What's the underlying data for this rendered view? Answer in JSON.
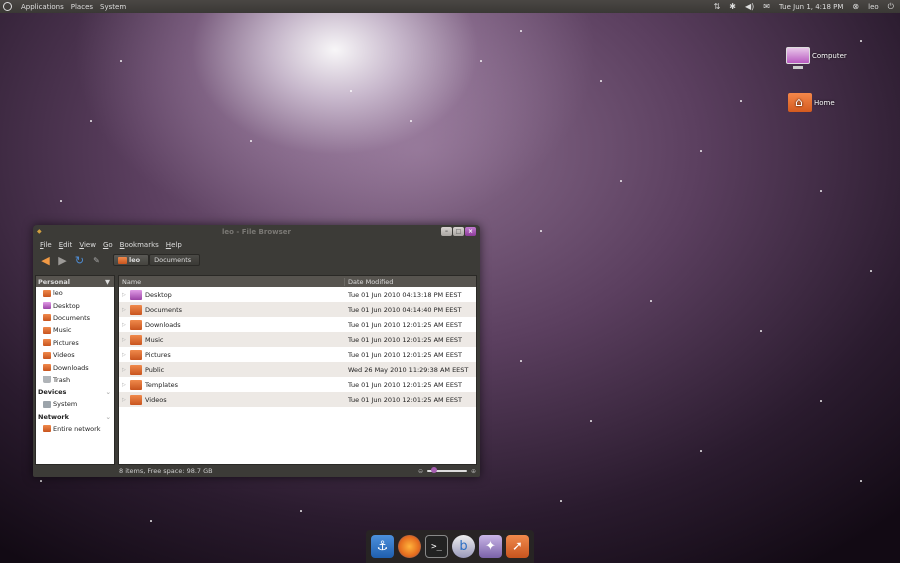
{
  "top_panel": {
    "menus": [
      "Applications",
      "Places",
      "System"
    ],
    "clock": "Tue Jun  1, 4:18 PM",
    "user": "leo"
  },
  "desktop_icons": [
    {
      "label": "Computer",
      "icon": "computer-icon"
    },
    {
      "label": "Home",
      "icon": "home-folder-icon"
    }
  ],
  "window": {
    "title": "leo - File Browser",
    "menu": [
      "File",
      "Edit",
      "View",
      "Go",
      "Bookmarks",
      "Help"
    ],
    "path": [
      "leo",
      "Documents"
    ],
    "sidebar": {
      "header": "Personal",
      "personal": [
        "leo",
        "Desktop",
        "Documents",
        "Music",
        "Pictures",
        "Videos",
        "Downloads",
        "Trash"
      ],
      "devices_label": "Devices",
      "devices": [
        "System"
      ],
      "network_label": "Network",
      "network": [
        "Entire network"
      ]
    },
    "columns": {
      "name": "Name",
      "date": "Date Modified"
    },
    "files": [
      {
        "name": "Desktop",
        "date": "Tue 01 Jun 2010 04:13:18 PM EEST"
      },
      {
        "name": "Documents",
        "date": "Tue 01 Jun 2010 04:14:40 PM EEST"
      },
      {
        "name": "Downloads",
        "date": "Tue 01 Jun 2010 12:01:25 AM EEST"
      },
      {
        "name": "Music",
        "date": "Tue 01 Jun 2010 12:01:25 AM EEST"
      },
      {
        "name": "Pictures",
        "date": "Tue 01 Jun 2010 12:01:25 AM EEST"
      },
      {
        "name": "Public",
        "date": "Wed 26 May 2010 11:29:38 AM EEST"
      },
      {
        "name": "Templates",
        "date": "Tue 01 Jun 2010 12:01:25 AM EEST"
      },
      {
        "name": "Videos",
        "date": "Tue 01 Jun 2010 12:01:25 AM EEST"
      }
    ],
    "status": "8 items, Free space: 98.7 GB",
    "zoom_level": 0.1
  },
  "dock": [
    "anchor-icon",
    "firefox-icon",
    "terminal-icon",
    "bird-icon",
    "pidgin-icon",
    "files-icon"
  ],
  "colors": {
    "accent": "#a55eb0",
    "folder": "#e46a1d",
    "panel": "#3c3b37"
  }
}
